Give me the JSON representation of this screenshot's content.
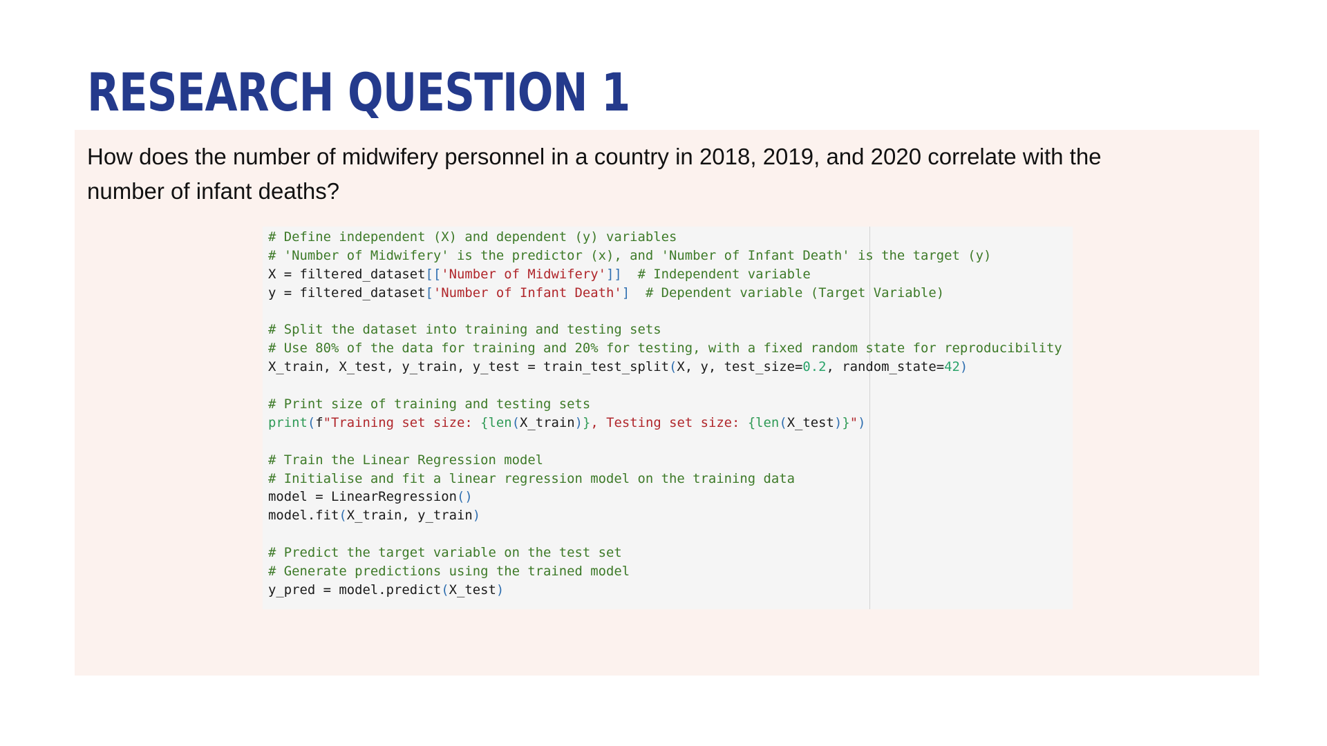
{
  "slide": {
    "title": "RESEARCH QUESTION 1",
    "question": "How does the number of midwifery personnel in a country in 2018, 2019, and 2020 correlate with the number of infant deaths?"
  },
  "colors": {
    "title": "#243a8c",
    "panel_background": "#fcf2ee",
    "code_background": "#f5f5f5",
    "comment": "#3d7a28",
    "string": "#b0262b",
    "bracket": "#2f6fb0",
    "number": "#2aa36a"
  },
  "code": {
    "lines": [
      [
        {
          "t": "comment",
          "v": "# Define independent (X) and dependent (y) variables"
        }
      ],
      [
        {
          "t": "comment",
          "v": "# 'Number of Midwifery' is the predictor (x), and 'Number of Infant Death' is the target (y)"
        }
      ],
      [
        {
          "t": "plain",
          "v": "X = filtered_dataset"
        },
        {
          "t": "punct",
          "v": "[["
        },
        {
          "t": "string",
          "v": "'Number of Midwifery'"
        },
        {
          "t": "punct",
          "v": "]]"
        },
        {
          "t": "plain",
          "v": "  "
        },
        {
          "t": "comment",
          "v": "# Independent variable"
        }
      ],
      [
        {
          "t": "plain",
          "v": "y = filtered_dataset"
        },
        {
          "t": "punct",
          "v": "["
        },
        {
          "t": "string",
          "v": "'Number of Infant Death'"
        },
        {
          "t": "punct",
          "v": "]"
        },
        {
          "t": "plain",
          "v": "  "
        },
        {
          "t": "comment",
          "v": "# Dependent variable (Target Variable)"
        }
      ],
      [],
      [
        {
          "t": "comment",
          "v": "# Split the dataset into training and testing sets"
        }
      ],
      [
        {
          "t": "comment",
          "v": "# Use 80% of the data for training and 20% for testing, with a fixed random state for reproducibility"
        }
      ],
      [
        {
          "t": "plain",
          "v": "X_train, X_test, y_train, y_test = train_test_split"
        },
        {
          "t": "punct",
          "v": "("
        },
        {
          "t": "plain",
          "v": "X, y, test_size="
        },
        {
          "t": "number",
          "v": "0.2"
        },
        {
          "t": "plain",
          "v": ", random_state="
        },
        {
          "t": "number",
          "v": "42"
        },
        {
          "t": "punct",
          "v": ")"
        }
      ],
      [],
      [
        {
          "t": "comment",
          "v": "# Print size of training and testing sets"
        }
      ],
      [
        {
          "t": "builtin",
          "v": "print"
        },
        {
          "t": "punct",
          "v": "("
        },
        {
          "t": "plain",
          "v": "f"
        },
        {
          "t": "string",
          "v": "\"Training set size: "
        },
        {
          "t": "builtin",
          "v": "{len"
        },
        {
          "t": "punct",
          "v": "("
        },
        {
          "t": "plain",
          "v": "X_train"
        },
        {
          "t": "punct",
          "v": ")"
        },
        {
          "t": "builtin",
          "v": "}"
        },
        {
          "t": "string",
          "v": ", Testing set size: "
        },
        {
          "t": "builtin",
          "v": "{len"
        },
        {
          "t": "punct",
          "v": "("
        },
        {
          "t": "plain",
          "v": "X_test"
        },
        {
          "t": "punct",
          "v": ")"
        },
        {
          "t": "builtin",
          "v": "}"
        },
        {
          "t": "string",
          "v": "\""
        },
        {
          "t": "punct",
          "v": ")"
        }
      ],
      [],
      [
        {
          "t": "comment",
          "v": "# Train the Linear Regression model"
        }
      ],
      [
        {
          "t": "comment",
          "v": "# Initialise and fit a linear regression model on the training data"
        }
      ],
      [
        {
          "t": "plain",
          "v": "model = LinearRegression"
        },
        {
          "t": "punct",
          "v": "()"
        }
      ],
      [
        {
          "t": "plain",
          "v": "model.fit"
        },
        {
          "t": "punct",
          "v": "("
        },
        {
          "t": "plain",
          "v": "X_train, y_train"
        },
        {
          "t": "punct",
          "v": ")"
        }
      ],
      [],
      [
        {
          "t": "comment",
          "v": "# Predict the target variable on the test set"
        }
      ],
      [
        {
          "t": "comment",
          "v": "# Generate predictions using the trained model"
        }
      ],
      [
        {
          "t": "plain",
          "v": "y_pred = model.predict"
        },
        {
          "t": "punct",
          "v": "("
        },
        {
          "t": "plain",
          "v": "X_test"
        },
        {
          "t": "punct",
          "v": ")"
        }
      ]
    ]
  }
}
